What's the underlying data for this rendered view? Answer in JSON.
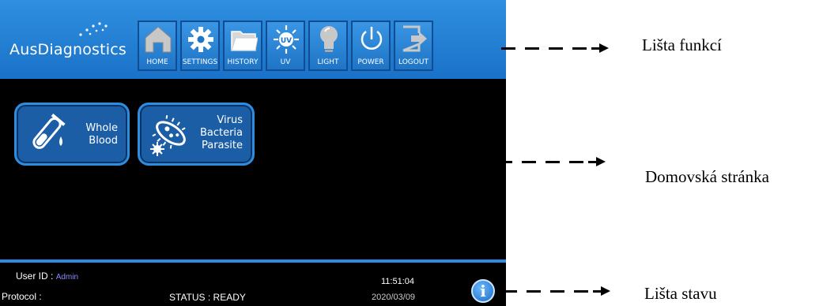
{
  "logo": {
    "text": "AusDiagnostics"
  },
  "toolbar": {
    "buttons": [
      {
        "label": "HOME",
        "icon": "home-icon"
      },
      {
        "label": "SETTINGS",
        "icon": "gear-icon"
      },
      {
        "label": "HISTORY",
        "icon": "folder-icon"
      },
      {
        "label": "UV",
        "icon": "uv-lamp-icon"
      },
      {
        "label": "LIGHT",
        "icon": "lightbulb-icon"
      },
      {
        "label": "POWER",
        "icon": "power-icon"
      },
      {
        "label": "LOGOUT",
        "icon": "logout-icon"
      }
    ]
  },
  "home": {
    "tiles": [
      {
        "label_lines": [
          "Whole",
          "Blood"
        ],
        "icon": "test-tube-icon"
      },
      {
        "label_lines": [
          "Virus",
          "Bacteria",
          "Parasite"
        ],
        "icon": "microbe-icon"
      }
    ]
  },
  "status": {
    "user_id_label": "User ID :",
    "user_id_value": "Admin",
    "protocol_label": "Protocol :",
    "status_text": "STATUS : READY",
    "time": "11:51:04",
    "date": "2020/03/09",
    "info_icon": "info-icon"
  },
  "callouts": {
    "toolbar": "Lišta funkcí",
    "homepage": "Domovská stránka",
    "statusbar": "Lišta stavu"
  },
  "colors": {
    "toolbar_blue": "#1a72c8",
    "tile_blue": "#1b5ea6",
    "accent_line": "#2a8be0",
    "background": "#000000"
  }
}
